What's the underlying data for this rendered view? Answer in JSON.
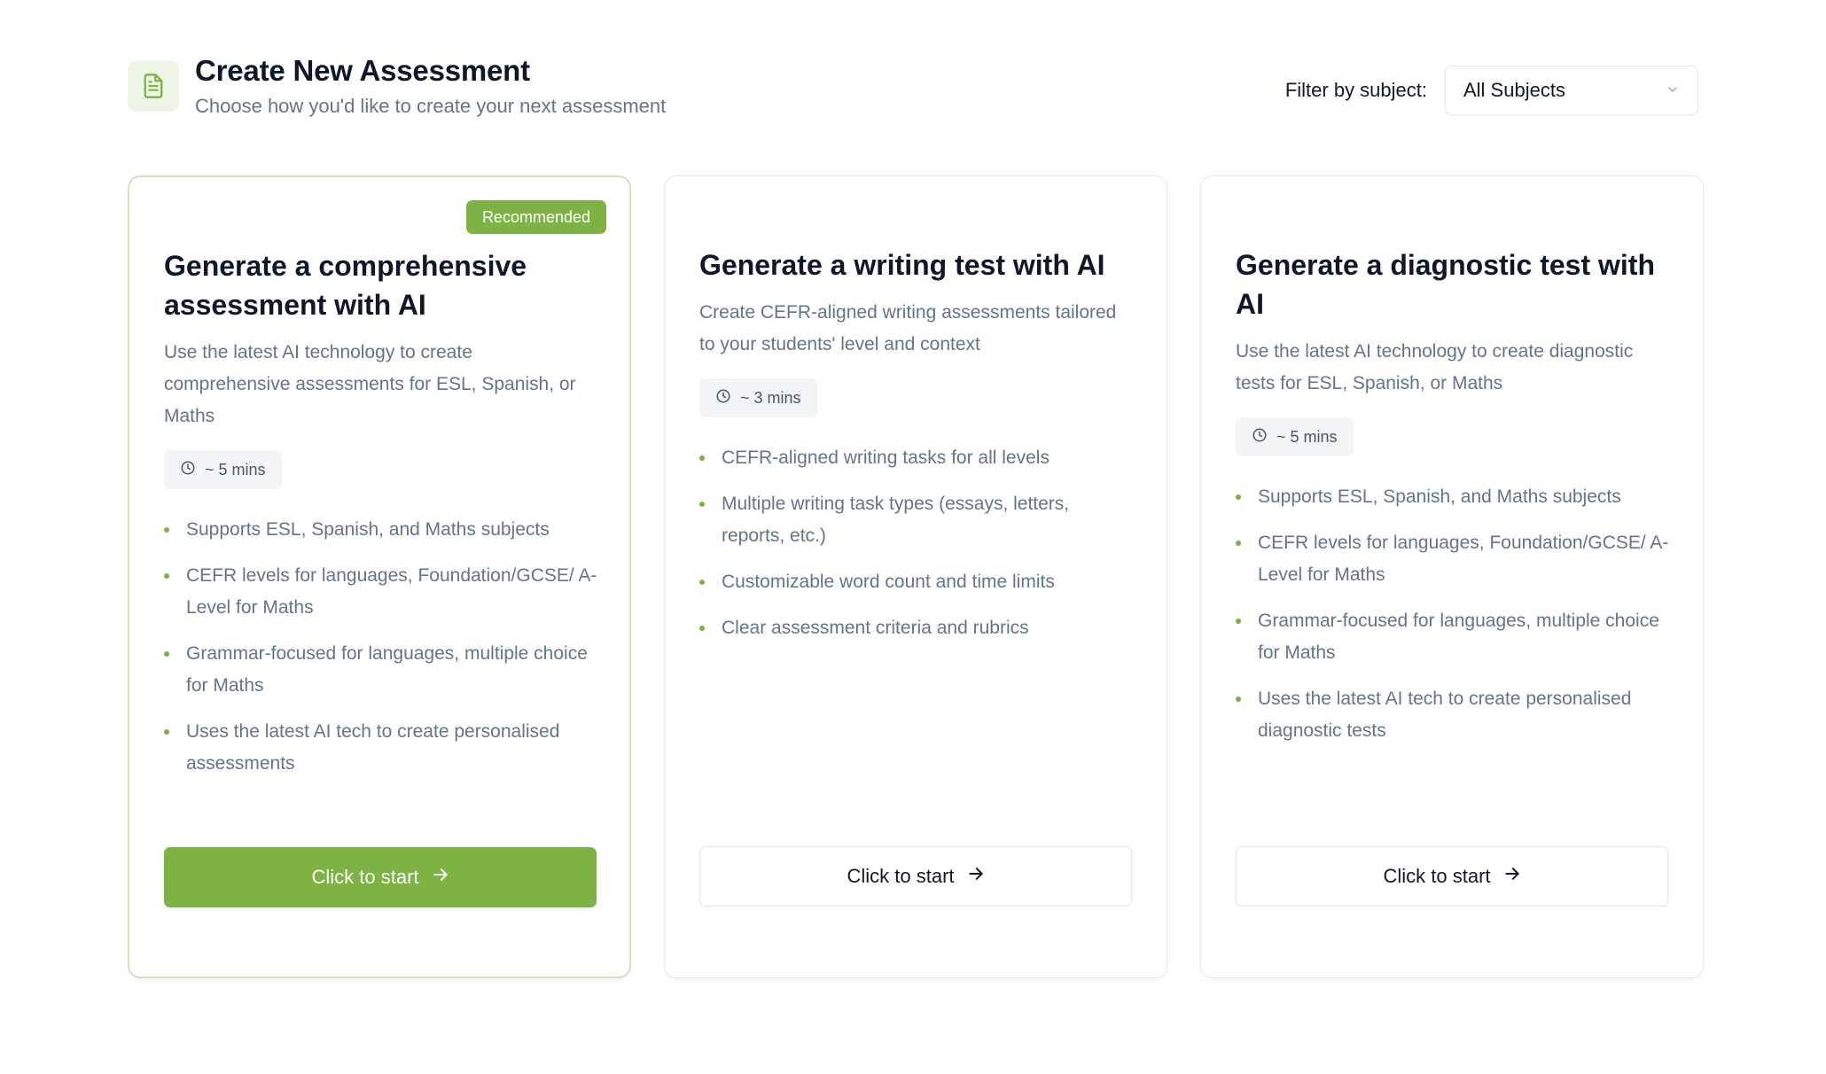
{
  "header": {
    "title": "Create New Assessment",
    "subtitle": "Choose how you'd like to create your next assessment",
    "icon": "document-icon"
  },
  "filter": {
    "label": "Filter by subject:",
    "selected": "All Subjects"
  },
  "colors": {
    "accent": "#7cb342",
    "accent_soft": "#eef5e6",
    "muted_text": "#64748b"
  },
  "cards": [
    {
      "badge": "Recommended",
      "title": "Generate a comprehensive assessment with AI",
      "description": "Use the latest AI technology to create comprehensive assessments for ESL, Spanish, or Maths",
      "time": "~ 5 mins",
      "features": [
        "Supports ESL, Spanish, and Maths subjects",
        "CEFR levels for languages, Foundation/GCSE/ A-Level for Maths",
        "Grammar-focused for languages, multiple choice for Maths",
        "Uses the latest AI tech to create personalised assessments"
      ],
      "button": "Click to start"
    },
    {
      "title": "Generate a writing test with AI",
      "description": "Create CEFR-aligned writing assessments tailored to your students' level and context",
      "time": "~ 3 mins",
      "features": [
        "CEFR-aligned writing tasks for all levels",
        "Multiple writing task types (essays, letters, reports, etc.)",
        "Customizable word count and time limits",
        "Clear assessment criteria and rubrics"
      ],
      "button": "Click to start"
    },
    {
      "title": "Generate a diagnostic test with AI",
      "description": "Use the latest AI technology to create diagnostic tests for ESL, Spanish, or Maths",
      "time": "~ 5 mins",
      "features": [
        "Supports ESL, Spanish, and Maths subjects",
        "CEFR levels for languages, Foundation/GCSE/ A-Level for Maths",
        "Grammar-focused for languages, multiple choice for Maths",
        "Uses the latest AI tech to create personalised diagnostic tests"
      ],
      "button": "Click to start"
    }
  ]
}
